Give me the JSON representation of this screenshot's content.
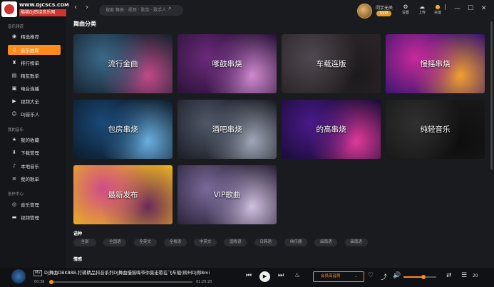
{
  "logo": {
    "site": "WWW.DJCSCS.COM",
    "sub": "酷猫DJ串烧音乐网"
  },
  "search": {
    "placeholder": "搜索 舞曲 · 视频 · 歌单 · 歌手人"
  },
  "user": {
    "name": "闵宇无关",
    "badge": "SVIP"
  },
  "toolbar": {
    "settings": "设置",
    "upload": "上传",
    "recharge": "充值"
  },
  "sidebar": {
    "section1": "音乐频道",
    "items1": [
      {
        "label": "精选推荐",
        "icon": "disc-icon"
      },
      {
        "label": "音乐曲库",
        "icon": "music-note-icon"
      },
      {
        "label": "排行榜单",
        "icon": "trophy-icon"
      },
      {
        "label": "精友歌单",
        "icon": "playlist-icon"
      },
      {
        "label": "电台连播",
        "icon": "radio-icon"
      },
      {
        "label": "视频大全",
        "icon": "video-icon"
      },
      {
        "label": "DJ音乐人",
        "icon": "users-icon"
      }
    ],
    "section2": "我的音乐",
    "items2": [
      {
        "label": "我的收藏",
        "icon": "star-icon"
      },
      {
        "label": "下载管理",
        "icon": "download-icon"
      },
      {
        "label": "本地音乐",
        "icon": "note-icon"
      },
      {
        "label": "我的歌单",
        "icon": "list-icon"
      }
    ],
    "section3": "创作中心",
    "items3": [
      {
        "label": "音乐管理",
        "icon": "disc-manage-icon"
      },
      {
        "label": "视频管理",
        "icon": "video-manage-icon"
      }
    ]
  },
  "main": {
    "title": "舞曲分类",
    "categories": [
      {
        "label": "流行金曲",
        "colors": [
          "#16222e",
          "#3a6a8a",
          "#c04a8a"
        ]
      },
      {
        "label": "嗲鼓串烧",
        "colors": [
          "#2a1238",
          "#6a2a7a",
          "#d08ad0"
        ]
      },
      {
        "label": "车载连版",
        "colors": [
          "#2a2428",
          "#504850",
          "#1c1a1c"
        ]
      },
      {
        "label": "慢摇串烧",
        "colors": [
          "#3a1670",
          "#c82a9a",
          "#f0a030"
        ]
      },
      {
        "label": "包房串烧",
        "colors": [
          "#0c1a2a",
          "#1a4a78",
          "#6ab0e0"
        ]
      },
      {
        "label": "酒吧串烧",
        "colors": [
          "#1a1c24",
          "#505868",
          "#a0a8b8"
        ]
      },
      {
        "label": "的高串烧",
        "colors": [
          "#1a0c38",
          "#4a1a8a",
          "#e03a9a"
        ]
      },
      {
        "label": "纯轻音乐",
        "colors": [
          "#181818",
          "#303030",
          "#0e0e0e"
        ]
      },
      {
        "label": "最新发布",
        "colors": [
          "#e8b020",
          "#d04a8a",
          "#6a2a5a"
        ]
      },
      {
        "label": "VIP歌曲",
        "colors": [
          "#2a2238",
          "#7a6a9a",
          "#d0c0e0"
        ]
      }
    ],
    "languages_title": "语种",
    "languages": [
      "全部",
      "全国语",
      "全英文",
      "全粤语",
      "中英文",
      "国粤语",
      "日韩语",
      "纯乐器",
      "闽南语",
      "闽南语"
    ],
    "mood_title": "情感"
  },
  "player": {
    "mv_badge": "MV",
    "song": "DJ舞曲DBK888-打碟精品抖音系列DJ舞曲慢摇嗨爷你莫走歌在飞车载(柳州DJ郑8mi",
    "current_time": "00:36",
    "total_time": "01:20:20",
    "progress": 0.008,
    "quality": "会员高音质",
    "volume": 0.6,
    "playlist_count": "20"
  }
}
